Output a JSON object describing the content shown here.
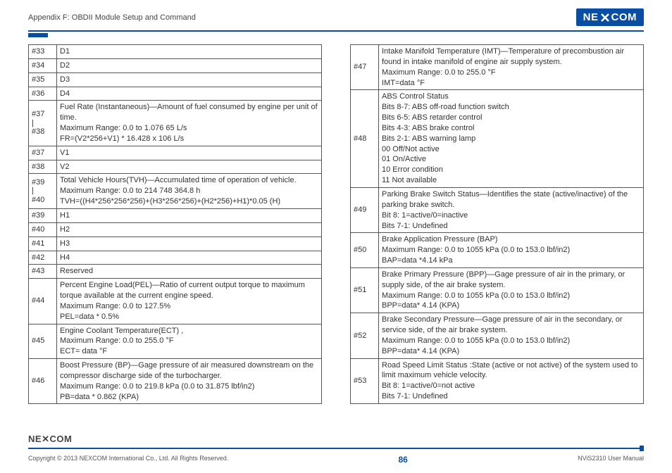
{
  "header": {
    "title": "Appendix F: OBDII Module Setup and Command",
    "logo": "NE COM"
  },
  "left_table": [
    {
      "idx": "#33",
      "desc": "D1"
    },
    {
      "idx": "#34",
      "desc": "D2"
    },
    {
      "idx": "#35",
      "desc": "D3"
    },
    {
      "idx": "#36",
      "desc": "D4"
    },
    {
      "idx": "#37\n|\n#38",
      "desc": "Fuel Rate (Instantaneous)—Amount of fuel consumed by engine per unit of time.\nMaximum Range: 0.0 to 1.076 65 L/s\nFR=(V2*256+V1) * 16.428 x 106 L/s"
    },
    {
      "idx": "#37",
      "desc": "V1"
    },
    {
      "idx": "#38",
      "desc": "V2"
    },
    {
      "idx": "#39\n|\n#40",
      "desc": "Total Vehicle Hours(TVH)—Accumulated time of operation of vehicle.\nMaximum Range: 0.0 to 214 748 364.8 h\nTVH=((H4*256*256*256)+(H3*256*256)+(H2*256)+H1)*0.05 (H)"
    },
    {
      "idx": "#39",
      "desc": "H1"
    },
    {
      "idx": "#40",
      "desc": "H2"
    },
    {
      "idx": "#41",
      "desc": "H3"
    },
    {
      "idx": "#42",
      "desc": "H4"
    },
    {
      "idx": "#43",
      "desc": "Reserved"
    },
    {
      "idx": "#44",
      "desc": "Percent Engine Load(PEL)—Ratio of current output torque to maximum torque available at the current engine speed.\nMaximum Range: 0.0 to 127.5%\nPEL=data * 0.5%"
    },
    {
      "idx": "#45",
      "desc": "Engine Coolant Temperature(ECT) ,\nMaximum Range: 0.0 to 255.0 °F\nECT= data °F"
    },
    {
      "idx": "#46",
      "desc": "Boost Pressure (BP)—Gage pressure of air measured downstream on the compressor discharge side of the turbocharger.\nMaximum Range: 0.0 to 219.8 kPa (0.0 to 31.875 lbf/in2)\nPB=data * 0.862 (KPA)"
    }
  ],
  "right_table": [
    {
      "idx": "#47",
      "desc": "Intake Manifold Temperature (IMT)—Temperature of precombustion air found in intake manifold of engine air supply system.\nMaximum Range: 0.0 to 255.0 °F\nIMT=data °F"
    },
    {
      "idx": "#48",
      "desc": "ABS Control Status\nBits 8-7: ABS off-road function switch\nBits 6-5: ABS retarder control\nBits 4-3: ABS brake control\nBits 2-1: ABS warning lamp\n00 Off/Not active\n01 On/Active\n10 Error condition\n11 Not available"
    },
    {
      "idx": "#49",
      "desc": "Parking Brake Switch Status—Identifies the state (active/inactive) of the parking brake switch.\nBit 8: 1=active/0=inactive\nBits 7-1: Undefined"
    },
    {
      "idx": "#50",
      "desc": "Brake Application Pressure (BAP)\nMaximum Range: 0.0 to 1055 kPa (0.0 to 153.0 lbf/in2)\nBAP=data *4.14 kPa"
    },
    {
      "idx": "#51",
      "desc": "Brake Primary Pressure (BPP)—Gage pressure of air in the primary, or supply side, of the air brake system.\nMaximum Range: 0.0 to 1055 kPa (0.0 to 153.0 lbf/in2)\nBPP=data* 4.14 (KPA)"
    },
    {
      "idx": "#52",
      "desc": "Brake Secondary Pressure—Gage pressure of air in the secondary, or service side, of the air brake system.\nMaximum Range: 0.0 to 1055 kPa (0.0 to 153.0 lbf/in2)\nBPP=data* 4.14 (KPA)"
    },
    {
      "idx": "#53",
      "desc": "Road Speed Limit Status :State (active or not active) of the system used to limit maximum vehicle velocity.\nBit 8: 1=active/0=not active\nBits 7-1: Undefined"
    }
  ],
  "footer": {
    "logo": "NE�X⁄COM",
    "copyright": "Copyright © 2013 NEXCOM International Co., Ltd. All Rights Reserved.",
    "page": "86",
    "manual": "NViS2310 User Manual"
  }
}
